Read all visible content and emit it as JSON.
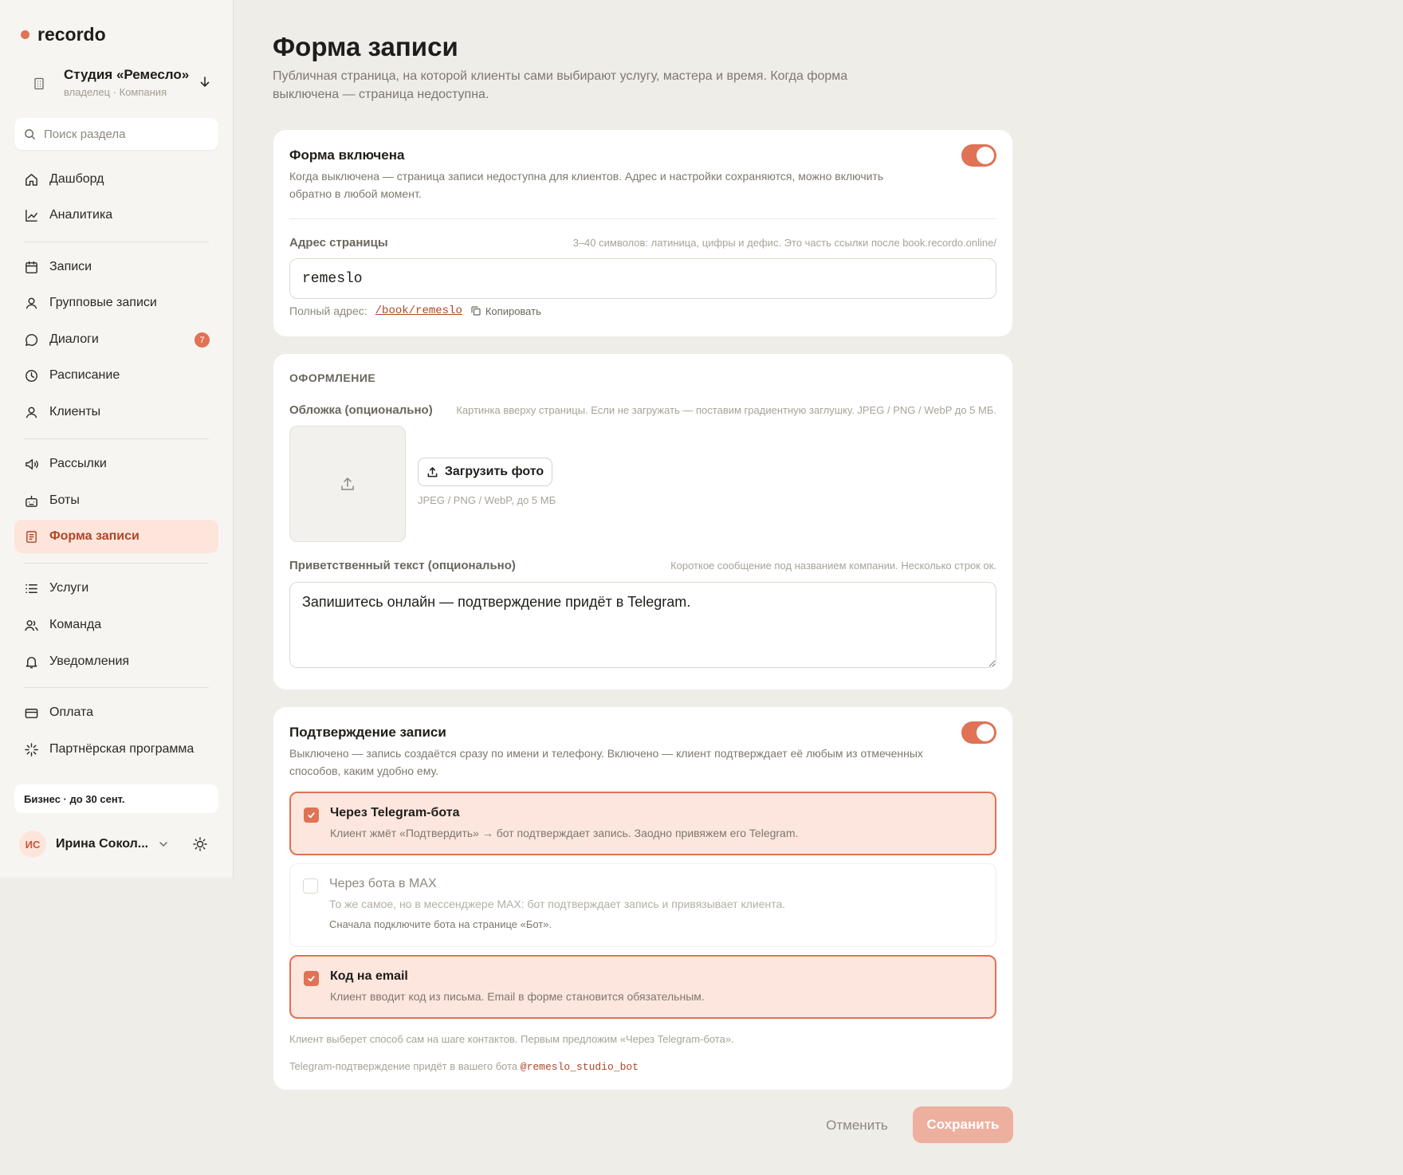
{
  "sidebar": {
    "logo": "recordo",
    "workspace": {
      "title": "Студия «Ремесло»",
      "subtitle": "владелец · Компания"
    },
    "search": {
      "placeholder": "Поиск раздела"
    },
    "nav": [
      {
        "label": "Дашборд",
        "icon": "home-icon"
      },
      {
        "label": "Аналитика",
        "icon": "chart-icon"
      },
      {
        "label": "Записи",
        "icon": "calendar-icon"
      },
      {
        "label": "Групповые записи",
        "icon": "user-icon"
      },
      {
        "label": "Диалоги",
        "icon": "chat-icon",
        "badge": "7"
      },
      {
        "label": "Расписание",
        "icon": "clock-icon"
      },
      {
        "label": "Клиенты",
        "icon": "user-icon"
      },
      {
        "label": "Рассылки",
        "icon": "megaphone-icon"
      },
      {
        "label": "Боты",
        "icon": "bot-icon"
      },
      {
        "label": "Форма записи",
        "icon": "form-icon",
        "active": true
      },
      {
        "label": "Услуги",
        "icon": "list-icon"
      },
      {
        "label": "Команда",
        "icon": "team-icon"
      },
      {
        "label": "Уведомления",
        "icon": "bell-icon"
      },
      {
        "label": "Оплата",
        "icon": "card-icon"
      },
      {
        "label": "Партнёрская программа",
        "icon": "sparkle-icon"
      }
    ],
    "plan": "Бизнес · до 30 сент.",
    "user": {
      "initials": "ИС",
      "name": "Ирина Сокол..."
    }
  },
  "page": {
    "title": "Форма записи",
    "description": "Публичная страница, на которой клиенты сами выбирают услугу, мастера и время. Когда форма выключена — страница недоступна."
  },
  "form_card": {
    "title": "Форма включена",
    "description": "Когда выключена — страница записи недоступна для клиентов. Адрес и настройки сохраняются, можно включить обратно в любой момент.",
    "enabled": true,
    "address_label": "Адрес страницы",
    "address_hint": "3–40 символов: латиница, цифры и дефис. Это часть ссылки после book.recordo.online/",
    "address_value": "remeslo",
    "full_address_label": "Полный адрес:",
    "full_address_link": "/book/remeslo",
    "copy_label": "Копировать"
  },
  "design_card": {
    "section_title": "ОФОРМЛЕНИЕ",
    "cover_label": "Обложка (опционально)",
    "cover_hint": "Картинка вверху страницы. Если не загружать — поставим градиентную заглушку. JPEG / PNG / WebP до 5 МБ.",
    "upload_button": "Загрузить фото",
    "upload_hint": "JPEG / PNG / WebP, до 5 МБ",
    "greeting_label": "Приветственный текст (опционально)",
    "greeting_hint": "Короткое сообщение под названием компании. Несколько строк ок.",
    "greeting_value": "Запишитесь онлайн — подтверждение придёт в Telegram."
  },
  "confirm_card": {
    "title": "Подтверждение записи",
    "description": "Выключено — запись создаётся сразу по имени и телефону. Включено — клиент подтверждает её любым из отмеченных способов, каким удобно ему.",
    "enabled": true,
    "options": [
      {
        "title": "Через Telegram-бота",
        "description": "Клиент жмёт «Подтвердить» → бот подтверждает запись. Заодно привяжем его Telegram.",
        "checked": true
      },
      {
        "title": "Через бота в MAX",
        "description": "То же самое, но в мессенджере MAX: бот подтверждает запись и привязывает клиента.",
        "note": "Сначала подключите бота на странице «Бот».",
        "checked": false,
        "disabled": true
      },
      {
        "title": "Код на email",
        "description": "Клиент вводит код из письма. Email в форме становится обязательным.",
        "checked": true
      }
    ],
    "note_1": "Клиент выберет способ сам на шаге контактов. Первым предложим «Через Telegram-бота».",
    "note_2_prefix": "Telegram-подтверждение придёт в вашего бота",
    "note_2_bot": "@remeslo_studio_bot"
  },
  "actions": {
    "cancel": "Отменить",
    "save": "Сохранить"
  },
  "colors": {
    "accent": "#e07256",
    "accent_soft": "#fde6de",
    "background": "#efede8"
  }
}
